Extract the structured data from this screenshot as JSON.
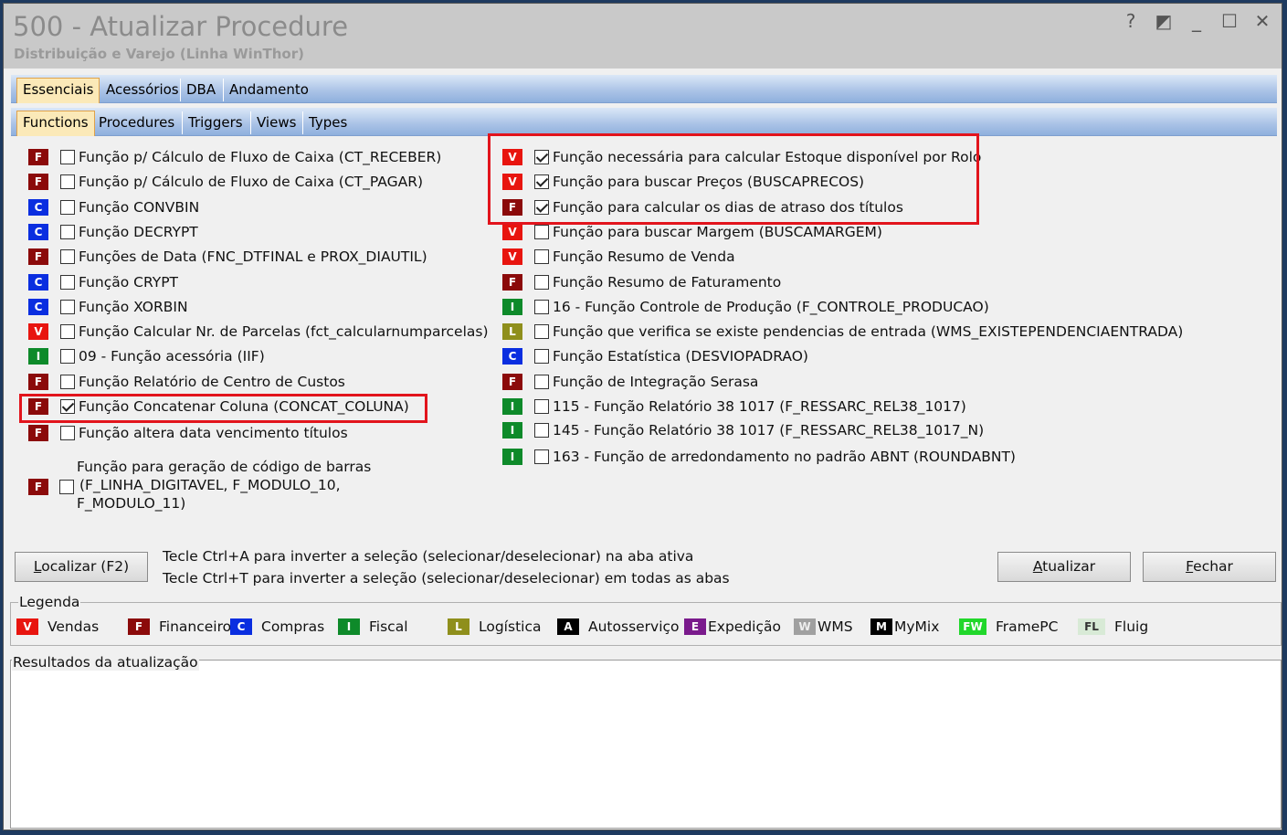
{
  "window": {
    "title": "500 - Atualizar Procedure",
    "subtitle": "Distribuição e Varejo (Linha WinThor)",
    "controls": [
      "?",
      "◩",
      "_",
      "☐",
      "✕"
    ]
  },
  "main_tabs": [
    "Essenciais",
    "Acessórios",
    "DBA",
    "Andamento"
  ],
  "sub_tabs": [
    "Functions",
    "Procedures",
    "Triggers",
    "Views",
    "Types"
  ],
  "left_items": [
    {
      "badge": "F",
      "label": "Função p/ Cálculo de Fluxo de Caixa (CT_RECEBER)",
      "checked": false
    },
    {
      "badge": "F",
      "label": "Função p/ Cálculo de Fluxo de Caixa (CT_PAGAR)",
      "checked": false
    },
    {
      "badge": "C",
      "label": "Função CONVBIN",
      "checked": false
    },
    {
      "badge": "C",
      "label": "Função DECRYPT",
      "checked": false
    },
    {
      "badge": "F",
      "label": "Funções de Data (FNC_DTFINAL e PROX_DIAUTIL)",
      "checked": false
    },
    {
      "badge": "C",
      "label": "Função CRYPT",
      "checked": false
    },
    {
      "badge": "C",
      "label": "Função XORBIN",
      "checked": false
    },
    {
      "badge": "V",
      "label": "Função Calcular Nr. de Parcelas (fct_calcularnumparcelas)",
      "checked": false
    },
    {
      "badge": "I",
      "label": "09 - Função acessória (IIF)",
      "checked": false
    },
    {
      "badge": "F",
      "label": "Função Relatório de Centro de Custos",
      "checked": false
    },
    {
      "badge": "F",
      "label": "Função Concatenar Coluna (CONCAT_COLUNA)",
      "checked": true
    },
    {
      "badge": "F",
      "label": "Função altera data vencimento títulos",
      "checked": false
    }
  ],
  "left_multiline_item": {
    "badge": "F",
    "lines": [
      "Função para geração de código de barras",
      "(F_LINHA_DIGITAVEL, F_MODULO_10,",
      "F_MODULO_11)"
    ],
    "checked": false
  },
  "right_items": [
    {
      "badge": "V",
      "label": "Função necessária para calcular Estoque disponível por Rolo",
      "checked": true
    },
    {
      "badge": "V",
      "label": "Função para buscar Preços (BUSCAPRECOS)",
      "checked": true
    },
    {
      "badge": "F",
      "label": "Função para calcular os dias de atraso dos títulos",
      "checked": true
    },
    {
      "badge": "V",
      "label": "Função para buscar Margem (BUSCAMARGEM)",
      "checked": false
    },
    {
      "badge": "V",
      "label": "Função Resumo de Venda",
      "checked": false
    },
    {
      "badge": "F",
      "label": "Função Resumo de Faturamento",
      "checked": false
    },
    {
      "badge": "I",
      "label": "16 - Função Controle de Produção (F_CONTROLE_PRODUCAO)",
      "checked": false
    },
    {
      "badge": "L",
      "label": "Função que verifica se existe pendencias de entrada (WMS_EXISTEPENDENCIAENTRADA)",
      "checked": false
    },
    {
      "badge": "C",
      "label": "Função Estatística (DESVIOPADRAO)",
      "checked": false
    },
    {
      "badge": "F",
      "label": "Função de Integração Serasa",
      "checked": false
    },
    {
      "badge": "I",
      "label": "115 - Função Relatório 38 1017 (F_RESSARC_REL38_1017)",
      "checked": false
    },
    {
      "badge": "I",
      "label": "145 - Função Relatório 38 1017 (F_RESSARC_REL38_1017_N)",
      "checked": false
    },
    {
      "badge": "I",
      "label": "163 - Função de arredondamento no padrão ABNT (ROUNDABNT)",
      "checked": false
    }
  ],
  "badge_colors": {
    "V": "#e8150f",
    "F": "#8b0a0a",
    "C": "#0a2ee0",
    "I": "#0e8a2a",
    "L": "#8f8f1c",
    "A": "#000000",
    "E": "#7a1a8c",
    "W": "#a0a0a0",
    "M": "#000000",
    "FW": "#21d72b",
    "FL": "#d8ead6"
  },
  "buttons": {
    "localizar": {
      "pre": "",
      "key": "L",
      "post": "ocalizar (F2)"
    },
    "atualizar": {
      "pre": "",
      "key": "A",
      "post": "tualizar"
    },
    "fechar": {
      "pre": "",
      "key": "F",
      "post": "echar"
    }
  },
  "hints": [
    "Tecle Ctrl+A para inverter a seleção (selecionar/deselecionar) na aba ativa",
    "Tecle Ctrl+T para inverter a seleção (selecionar/deselecionar) em todas as abas"
  ],
  "legend": {
    "title": "Legenda",
    "items": [
      {
        "badge": "V",
        "label": "Vendas"
      },
      {
        "badge": "F",
        "label": "Financeiro"
      },
      {
        "badge": "C",
        "label": "Compras"
      },
      {
        "badge": "I",
        "label": "Fiscal"
      },
      {
        "badge": "L",
        "label": "Logística"
      },
      {
        "badge": "A",
        "label": "Autosserviço"
      },
      {
        "badge": "E",
        "label": "Expedição"
      },
      {
        "badge": "W",
        "label": "WMS"
      },
      {
        "badge": "M",
        "label": "MyMix"
      },
      {
        "badge": "FW",
        "label": "FramePC"
      },
      {
        "badge": "FL",
        "label": "Fluig"
      }
    ]
  },
  "results": {
    "title": "Resultados da atualização"
  }
}
